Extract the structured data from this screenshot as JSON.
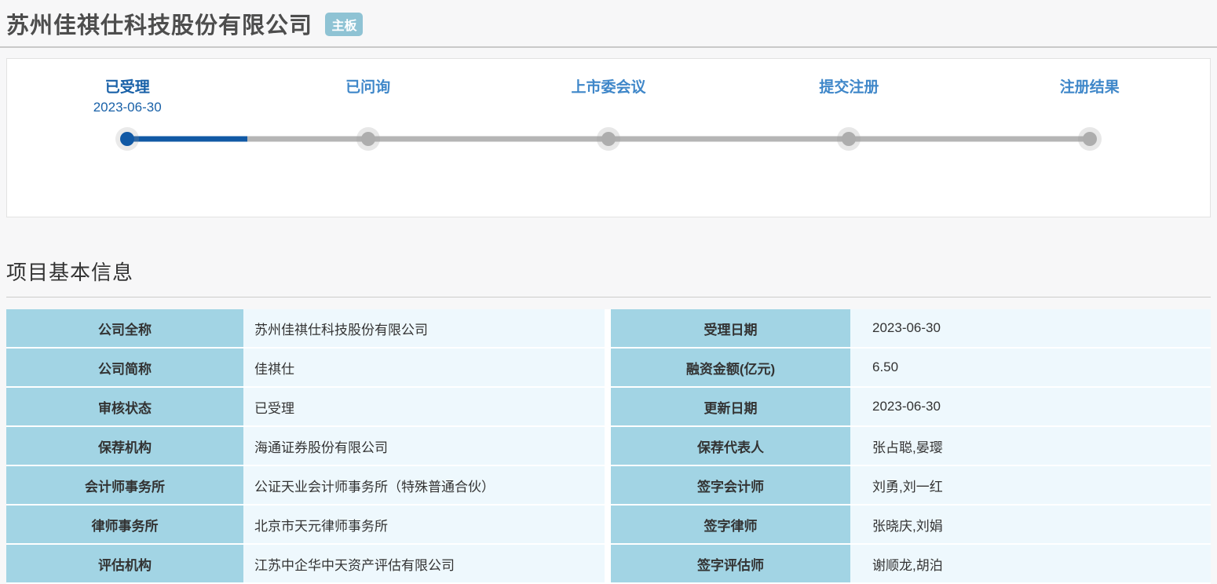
{
  "page": {
    "title": "苏州佳祺仕科技股份有限公司",
    "board_badge": "主板"
  },
  "timeline": {
    "stages": [
      {
        "label": "已受理",
        "date": "2023-06-30",
        "state": "active"
      },
      {
        "label": "已问询",
        "date": "",
        "state": "pending"
      },
      {
        "label": "上市委会议",
        "date": "",
        "state": "pending"
      },
      {
        "label": "提交注册",
        "date": "",
        "state": "pending"
      },
      {
        "label": "注册结果",
        "date": "",
        "state": "pending"
      }
    ],
    "progress_percent_of_track": 12.5
  },
  "section": {
    "title": "项目基本信息"
  },
  "info_table": {
    "rows": [
      {
        "left_label": "公司全称",
        "left_value": "苏州佳祺仕科技股份有限公司",
        "right_label": "受理日期",
        "right_value": "2023-06-30"
      },
      {
        "left_label": "公司简称",
        "left_value": "佳祺仕",
        "right_label": "融资金额(亿元)",
        "right_value": "6.50"
      },
      {
        "left_label": "审核状态",
        "left_value": "已受理",
        "right_label": "更新日期",
        "right_value": "2023-06-30"
      },
      {
        "left_label": "保荐机构",
        "left_value": "海通证券股份有限公司",
        "right_label": "保荐代表人",
        "right_value": "张占聪,晏璎"
      },
      {
        "left_label": "会计师事务所",
        "left_value": "公证天业会计师事务所（特殊普通合伙）",
        "right_label": "签字会计师",
        "right_value": "刘勇,刘一红"
      },
      {
        "left_label": "律师事务所",
        "left_value": "北京市天元律师事务所",
        "right_label": "签字律师",
        "right_value": "张晓庆,刘娟"
      },
      {
        "left_label": "评估机构",
        "left_value": "江苏中企华中天资产评估有限公司",
        "right_label": "签字评估师",
        "right_value": "谢顺龙,胡泊"
      }
    ]
  },
  "colors": {
    "page_background": "#f7f7f8",
    "badge_background": "#8fc3d4",
    "active_stage_blue": "#1159a5",
    "active_label_blue": "#1961a8",
    "pending_label_blue": "#3f87c9",
    "track_gray": "#b5b5b5",
    "table_label_background": "#a2d4e4",
    "table_value_background": "#eef8fd"
  }
}
